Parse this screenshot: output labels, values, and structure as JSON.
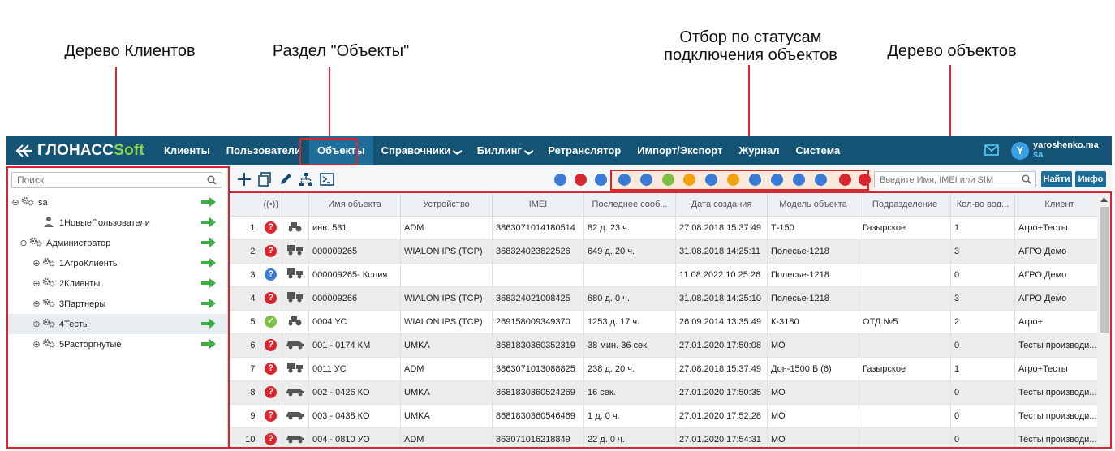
{
  "annotations": {
    "client_tree": "Дерево Клиентов",
    "objects_section": "Раздел \"Объекты\"",
    "status_filter_line1": "Отбор по статусам",
    "status_filter_line2": "подключения объектов",
    "object_tree": "Дерево объектов"
  },
  "brand": {
    "text": "ГЛОНАСС",
    "accent": "Soft"
  },
  "nav": [
    {
      "label": "Клиенты"
    },
    {
      "label": "Пользователи"
    },
    {
      "label": "Объекты",
      "active": true
    },
    {
      "label": "Справочники",
      "dropdown": true
    },
    {
      "label": "Биллинг",
      "dropdown": true
    },
    {
      "label": "Ретранслятор"
    },
    {
      "label": "Импорт/Экспорт"
    },
    {
      "label": "Журнал"
    },
    {
      "label": "Система"
    }
  ],
  "user": {
    "avatar_letter": "Y",
    "name": "yaroshenko.ma",
    "sub": "sa"
  },
  "left": {
    "search_placeholder": "Поиск",
    "tree": [
      {
        "label": "sa",
        "toggle": "⊖",
        "icon": "gears-icon"
      },
      {
        "label": "1НовыеПользователи",
        "toggle": "",
        "icon": "user-icon"
      },
      {
        "label": "Администратор",
        "toggle": "⊖",
        "icon": "gears-icon"
      },
      {
        "label": "1АгроКлиенты",
        "toggle": "⊕",
        "icon": "gears-icon"
      },
      {
        "label": "2Клиенты",
        "toggle": "⊕",
        "icon": "gears-icon"
      },
      {
        "label": "3Партнеры",
        "toggle": "⊕",
        "icon": "gears-icon"
      },
      {
        "label": "4Тесты",
        "toggle": "⊕",
        "icon": "gears-icon",
        "selected": true
      },
      {
        "label": "5Расторгнутые",
        "toggle": "⊕",
        "icon": "gears-icon"
      }
    ]
  },
  "toolbar": {
    "search_placeholder": "Введите Имя, IMEI или SIM",
    "find_label": "Найти",
    "info_label": "Инфо"
  },
  "colors": {
    "nav_bg": "#145374",
    "nav_active": "#1f6e99",
    "status_red": "#d9262e",
    "status_green": "#7cc043",
    "status_blue": "#3a7bd5",
    "annotation": "#d9262e"
  },
  "table": {
    "headers": [
      "",
      "((•))",
      "",
      "Имя объекта",
      "Устройство",
      "IMEI",
      "Последнее сооб...",
      "Дата создания",
      "Модель объекта",
      "Подразделение",
      "Кол-во вод...",
      "Клиент"
    ],
    "rows": [
      {
        "n": "1",
        "status": "unknown",
        "vehicle": "tractor",
        "name": "инв. 531",
        "device": "ADM",
        "imei": "3863071014180514",
        "last": "82 д. 23 ч.",
        "created": "27.08.2018 15:37:49",
        "model": "Т-150",
        "division": "Газырское",
        "drivers": "1",
        "client": "Агро+Тесты"
      },
      {
        "n": "2",
        "status": "unknown",
        "vehicle": "truck",
        "name": "000009265",
        "device": "WIALON IPS (TCP)",
        "imei": "368324023822526",
        "last": "649 д. 20 ч.",
        "created": "31.08.2018 14:25:11",
        "model": "Полесье-1218",
        "division": "",
        "drivers": "3",
        "client": "АГРО Демо"
      },
      {
        "n": "3",
        "status": "noconn",
        "vehicle": "truck",
        "name": "000009265- Копия",
        "device": "",
        "imei": "",
        "last": "",
        "created": "11.08.2022 10:25:26",
        "model": "Полесье-1218",
        "division": "",
        "drivers": "0",
        "client": "АГРО Демо"
      },
      {
        "n": "4",
        "status": "unknown",
        "vehicle": "truck",
        "name": "000009266",
        "device": "WIALON IPS (TCP)",
        "imei": "368324021008425",
        "last": "680 д. 0 ч.",
        "created": "31.08.2018 14:25:10",
        "model": "Полесье-1218",
        "division": "",
        "drivers": "3",
        "client": "АГРО Демо"
      },
      {
        "n": "5",
        "status": "ok",
        "vehicle": "tractor",
        "name": "0004 УС",
        "device": "WIALON IPS (TCP)",
        "imei": "269158009349370",
        "last": "1253 д. 17 ч.",
        "created": "26.09.2014 13:35:49",
        "model": "К-3180",
        "division": "ОТД.№5",
        "drivers": "2",
        "client": "Агро+"
      },
      {
        "n": "6",
        "status": "unknown",
        "vehicle": "car",
        "name": "001 - 0174 КМ",
        "device": "UMKA",
        "imei": "8681830360352319",
        "last": "38 мин. 36 сек.",
        "created": "27.01.2020 17:50:08",
        "model": "МО",
        "division": "",
        "drivers": "0",
        "client": "Тесты производи..."
      },
      {
        "n": "7",
        "status": "unknown",
        "vehicle": "truck",
        "name": "0011 УС",
        "device": "ADM",
        "imei": "3863071013088825",
        "last": "238 д. 20 ч.",
        "created": "27.08.2018 15:37:49",
        "model": "Дон-1500 Б (6)",
        "division": "Газырское",
        "drivers": "1",
        "client": "Агро+Тесты"
      },
      {
        "n": "8",
        "status": "unknown",
        "vehicle": "car",
        "name": "002 - 0426 КО",
        "device": "UMKA",
        "imei": "8681830360524269",
        "last": "16 сек.",
        "created": "27.01.2020 17:50:35",
        "model": "МО",
        "division": "",
        "drivers": "0",
        "client": "Тесты производи..."
      },
      {
        "n": "9",
        "status": "unknown",
        "vehicle": "car",
        "name": "003 - 0438 КО",
        "device": "UMKA",
        "imei": "8681830360546469",
        "last": "1 д. 0 ч.",
        "created": "27.01.2020 17:52:28",
        "model": "МО",
        "division": "",
        "drivers": "0",
        "client": "Тесты производи..."
      },
      {
        "n": "10",
        "status": "unknown",
        "vehicle": "car",
        "name": "004 - 0810 УО",
        "device": "ADM",
        "imei": "863071016218849",
        "last": "22 д. 0 ч.",
        "created": "27.01.2020 17:54:31",
        "model": "МО",
        "division": "",
        "drivers": "0",
        "client": "Тесты производи..."
      }
    ]
  }
}
